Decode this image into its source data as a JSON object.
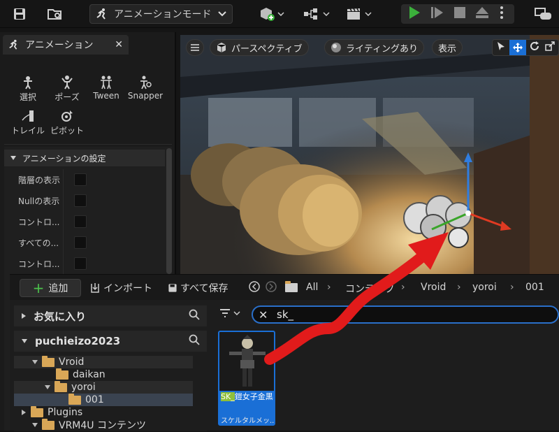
{
  "toolbar": {
    "mode_label": "アニメーションモード"
  },
  "left_panel": {
    "tab_title": "アニメーション",
    "tools": [
      {
        "label": "選択",
        "icon": "select-tool-icon"
      },
      {
        "label": "ポーズ",
        "icon": "pose-tool-icon"
      },
      {
        "label": "Tween",
        "icon": "tween-tool-icon"
      },
      {
        "label": "Snapper",
        "icon": "snapper-tool-icon"
      },
      {
        "label": "トレイル",
        "icon": "trail-tool-icon"
      },
      {
        "label": "ピボット",
        "icon": "pivot-tool-icon"
      }
    ],
    "section_title": "アニメーションの設定",
    "settings": [
      {
        "label": "階層の表示",
        "checked": false
      },
      {
        "label": "Nullの表示",
        "checked": false
      },
      {
        "label": "コントロ...",
        "checked": false
      },
      {
        "label": "すべての...",
        "checked": false
      },
      {
        "label": "コントロ...",
        "checked": false
      }
    ]
  },
  "viewport": {
    "perspective_label": "パースペクティブ",
    "lighting_label": "ライティングあり",
    "show_label": "表示"
  },
  "content_browser": {
    "add_label": "追加",
    "import_label": "インポート",
    "save_all_label": "すべて保存",
    "breadcrumb": [
      "All",
      "コンテンツ",
      "Vroid",
      "yoroi",
      "001"
    ],
    "favorites_label": "お気に入り",
    "project_label": "puchieizo2023",
    "tree": [
      {
        "label": "Vroid",
        "indent": 1,
        "open": true,
        "selected": false
      },
      {
        "label": "daikan",
        "indent": 2,
        "open": false,
        "selected": false
      },
      {
        "label": "yoroi",
        "indent": 2,
        "open": true,
        "selected": false
      },
      {
        "label": "001",
        "indent": 3,
        "open": false,
        "selected": true
      },
      {
        "label": "Plugins",
        "indent": 0,
        "open": false,
        "selected": false
      },
      {
        "label": "VRM4U コンテンツ",
        "indent": 1,
        "open": false,
        "selected": false
      }
    ],
    "search_value": "sk_",
    "asset": {
      "name_highlight": "SK_",
      "name_rest": "鎧女子金黒",
      "type_label": "スケルタルメッ..."
    }
  },
  "colors": {
    "accent_blue": "#1a6fd6",
    "play_green": "#3bb03b",
    "folder_yellow": "#d9a757",
    "annotation_red": "#e11b1b"
  }
}
